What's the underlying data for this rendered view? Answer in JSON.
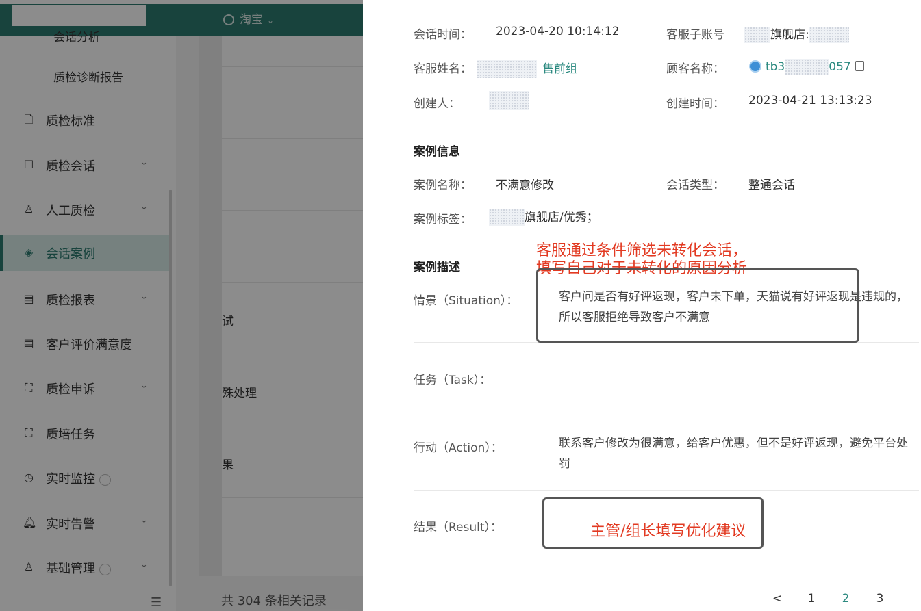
{
  "topbar": {
    "platform": "淘宝"
  },
  "sidebar": {
    "clipped_item": "会话分析",
    "sub_item": "质检诊断报告",
    "items": [
      {
        "label": "质检标准",
        "icon": "document-icon",
        "chevron": false,
        "info": false
      },
      {
        "label": "质检会话",
        "icon": "chat-icon",
        "chevron": true,
        "info": false
      },
      {
        "label": "人工质检",
        "icon": "user-check-icon",
        "chevron": true,
        "info": false
      },
      {
        "label": "会话案例",
        "icon": "layers-icon",
        "chevron": false,
        "info": false,
        "active": true
      },
      {
        "label": "质检报表",
        "icon": "report-icon",
        "chevron": true,
        "info": false
      },
      {
        "label": "客户评价满意度",
        "icon": "report-icon",
        "chevron": false,
        "info": false
      },
      {
        "label": "质检申诉",
        "icon": "frame-icon",
        "chevron": true,
        "info": false
      },
      {
        "label": "质培任务",
        "icon": "frame-icon",
        "chevron": false,
        "info": false
      },
      {
        "label": "实时监控",
        "icon": "clock-icon",
        "chevron": false,
        "info": true
      },
      {
        "label": "实时告警",
        "icon": "bell-icon",
        "chevron": true,
        "info": false
      },
      {
        "label": "基础管理",
        "icon": "user-settings-icon",
        "chevron": true,
        "info": true
      }
    ]
  },
  "middle": {
    "cells": [
      "试",
      "殊处理",
      "果"
    ],
    "footer": "共 304 条相关记录"
  },
  "drawer": {
    "session_time_label": "会话时间：",
    "session_time": "2023-04-20 10:14:12",
    "sub_account_label": "客服子账号",
    "sub_account_value": "旗舰店:",
    "agent_name_label": "客服姓名：",
    "agent_group": "售前组",
    "customer_label": "顾客名称：",
    "customer_prefix": "tb3",
    "customer_suffix": "057",
    "creator_label": "创建人：",
    "created_time_label": "创建时间：",
    "created_time": "2023-04-21 13:13:23",
    "case_info_title": "案例信息",
    "case_name_label": "案例名称：",
    "case_name": "不满意修改",
    "session_type_label": "会话类型：",
    "session_type": "整通会话",
    "case_tag_label": "案例标签：",
    "case_tag": "旗舰店/优秀；",
    "case_desc_title": "案例描述",
    "situation_label": "情景（Situation）：",
    "situation_text": "客户问是否有好评返现，客户未下单，天猫说有好评返现是违规的，所以客服拒绝导致客户不满意",
    "task_label": "任务（Task）：",
    "action_label": "行动（Action）：",
    "action_text": "联系客户修改为很满意，给客户优惠，但不是好评返现，避免平台处罚",
    "result_label": "结果（Result）："
  },
  "annotations": {
    "note1_line1": "客服通过条件筛选未转化会话，",
    "note1_line2": "填写自己对于未转化的原因分析",
    "note2": "主管/组长填写优化建议",
    "color": "#e23a22"
  },
  "pager": [
    "<",
    "1",
    "2",
    "3"
  ]
}
